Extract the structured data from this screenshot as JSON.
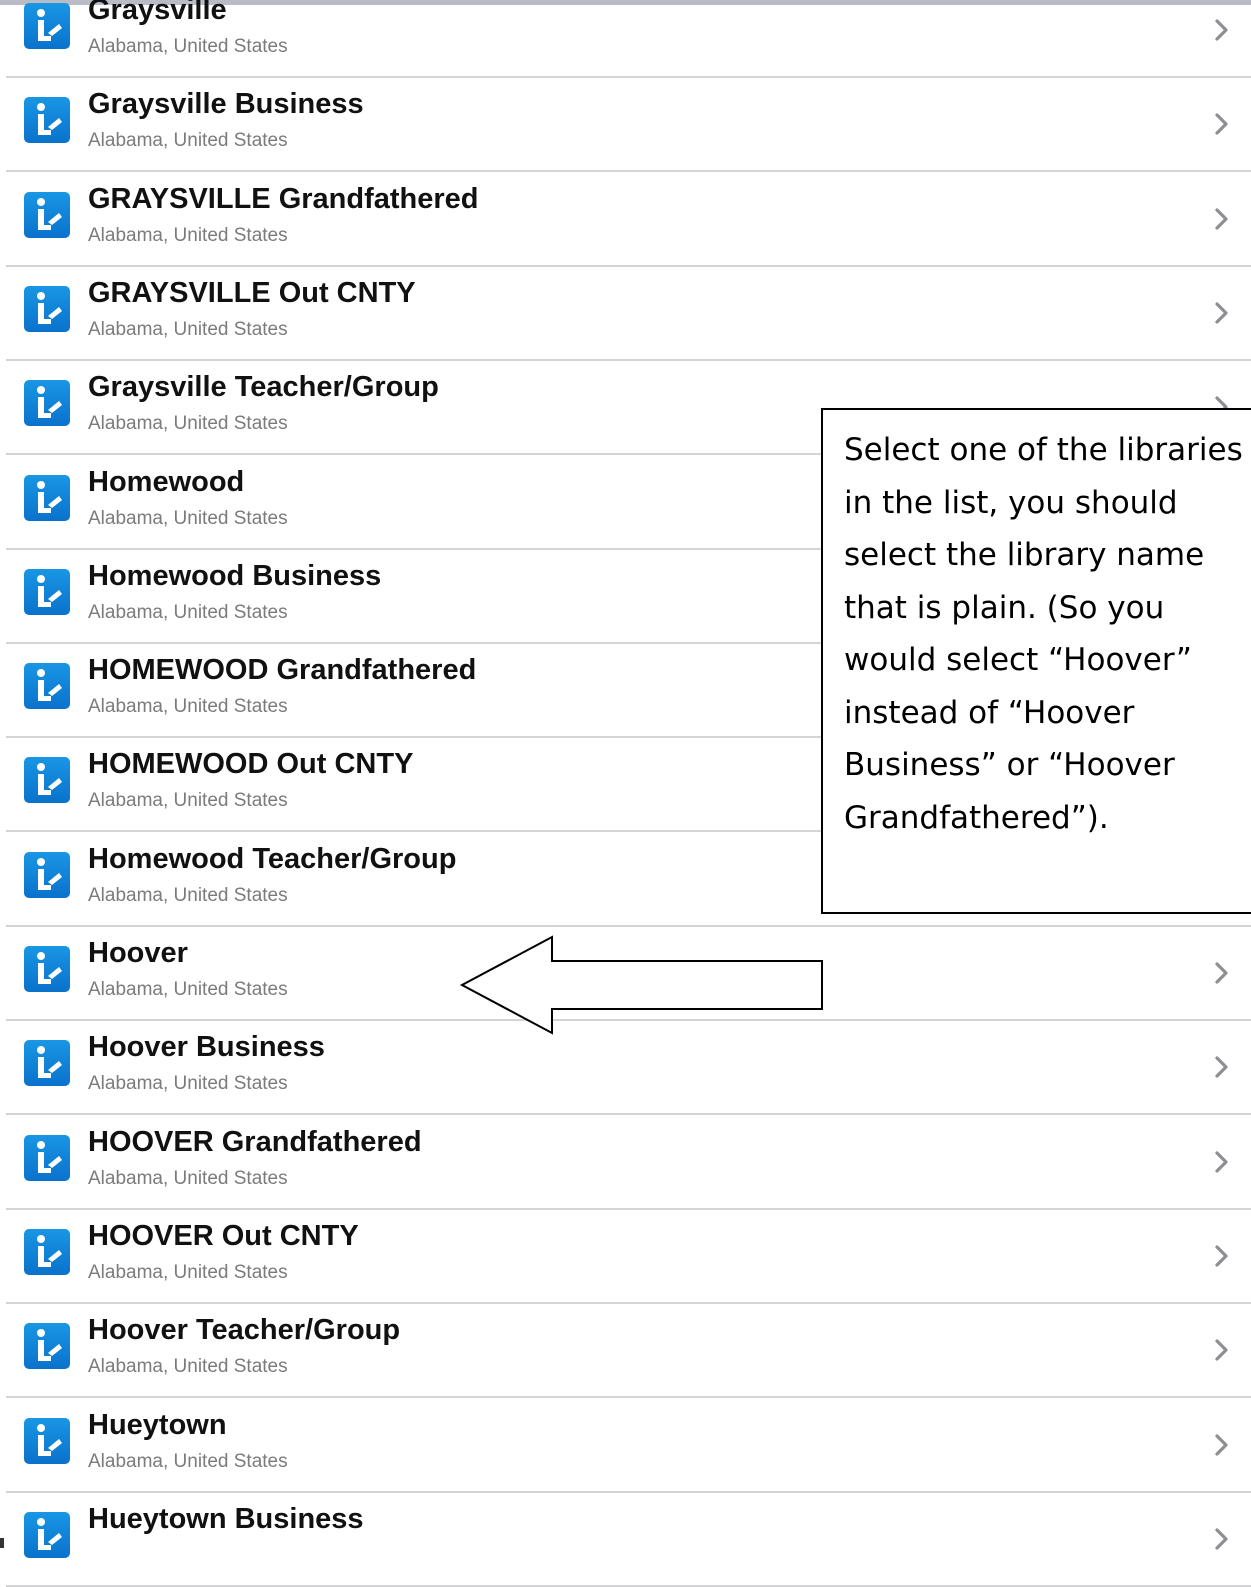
{
  "libraries": [
    {
      "name": "Graysville",
      "location": "Alabama, United States"
    },
    {
      "name": "Graysville Business",
      "location": "Alabama, United States"
    },
    {
      "name": "GRAYSVILLE Grandfathered",
      "location": "Alabama, United States"
    },
    {
      "name": "GRAYSVILLE Out CNTY",
      "location": "Alabama, United States"
    },
    {
      "name": "Graysville Teacher/Group",
      "location": "Alabama, United States"
    },
    {
      "name": "Homewood",
      "location": "Alabama, United States"
    },
    {
      "name": "Homewood Business",
      "location": "Alabama, United States"
    },
    {
      "name": "HOMEWOOD Grandfathered",
      "location": "Alabama, United States"
    },
    {
      "name": "HOMEWOOD Out CNTY",
      "location": "Alabama, United States"
    },
    {
      "name": "Homewood Teacher/Group",
      "location": "Alabama, United States"
    },
    {
      "name": "Hoover",
      "location": "Alabama, United States"
    },
    {
      "name": "Hoover Business",
      "location": "Alabama, United States"
    },
    {
      "name": "HOOVER Grandfathered",
      "location": "Alabama, United States"
    },
    {
      "name": "HOOVER Out CNTY",
      "location": "Alabama, United States"
    },
    {
      "name": "Hoover Teacher/Group",
      "location": "Alabama, United States"
    },
    {
      "name": "Hueytown",
      "location": "Alabama, United States"
    },
    {
      "name": "Hueytown Business",
      "location": ""
    }
  ],
  "callout": {
    "text": "Select one of the libraries in the list, you should select the library name that is plain. (So you would select “Hoover” instead of “Hoover Business” or “Hoover Grandfathered”)."
  },
  "icons": {
    "library": "library-app-icon",
    "chevron": "chevron-right-icon",
    "pointer": "left-arrow-icon"
  },
  "colors": {
    "icon_blue": "#0f82d6",
    "separator": "#d4d4d6",
    "chevron": "#8e8e93",
    "subtitle": "#7b7b7b"
  }
}
